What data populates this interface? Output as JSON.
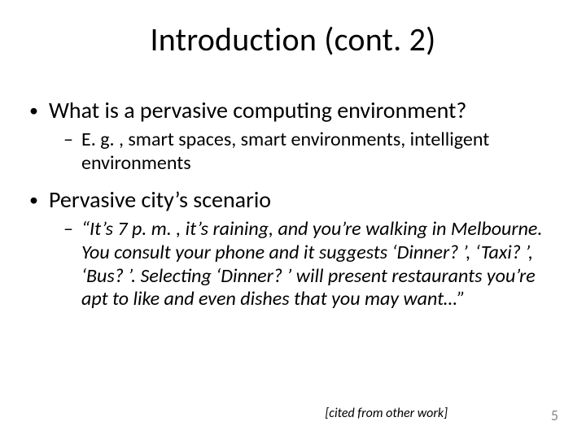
{
  "title": "Introduction (cont. 2)",
  "bullets": [
    {
      "text": "What is a pervasive computing environment?",
      "sub": {
        "text": "E. g. , smart spaces, smart environments, intelligent environments",
        "italic": false
      }
    },
    {
      "text": "Pervasive city’s scenario",
      "sub": {
        "text": "“It’s 7 p. m. , it’s raining, and you’re walking in Melbourne. You consult your phone and it suggests ‘Dinner? ’, ‘Taxi? ’, ‘Bus? ’. Selecting ‘Dinner? ’ will present restaurants you’re apt to like and even dishes that you may want…”",
        "italic": true
      }
    }
  ],
  "citation": "[cited from other work]",
  "page_number": "5"
}
